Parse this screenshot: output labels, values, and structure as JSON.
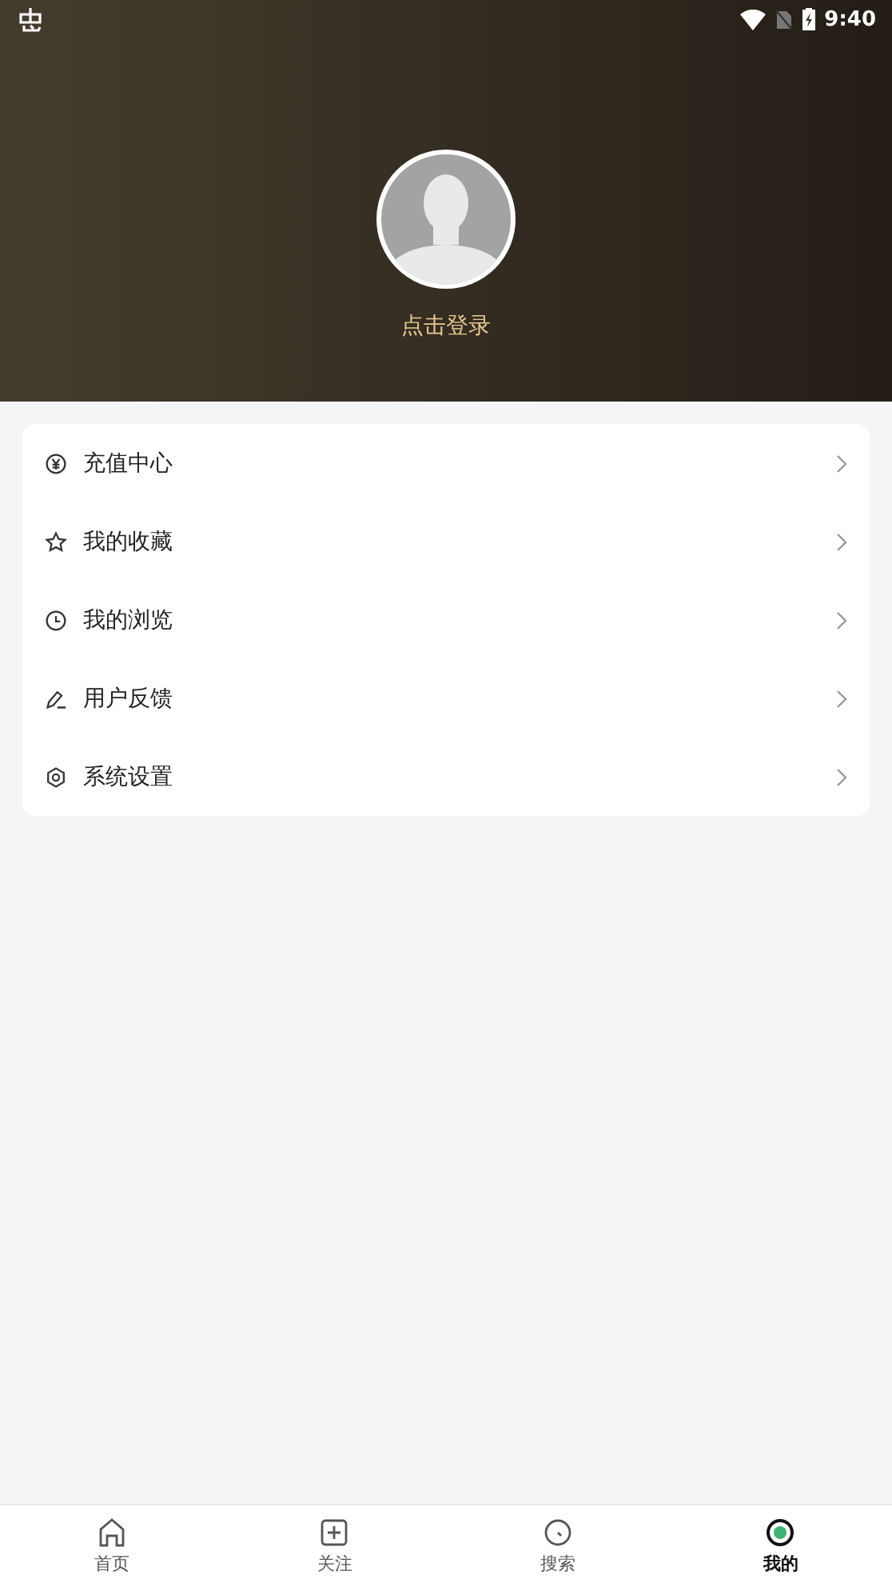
{
  "status_bar": {
    "time": "9:40"
  },
  "profile": {
    "login_label": "点击登录"
  },
  "menu": [
    {
      "kind": "yuan",
      "label": "充值中心"
    },
    {
      "kind": "star",
      "label": "我的收藏"
    },
    {
      "kind": "clock",
      "label": "我的浏览"
    },
    {
      "kind": "pen",
      "label": "用户反馈"
    },
    {
      "kind": "gear",
      "label": "系统设置"
    }
  ],
  "tabs": [
    {
      "kind": "home",
      "label": "首页",
      "selected": false
    },
    {
      "kind": "plus",
      "label": "关注",
      "selected": false
    },
    {
      "kind": "search",
      "label": "搜索",
      "selected": false
    },
    {
      "kind": "me",
      "label": "我的",
      "selected": true
    }
  ]
}
